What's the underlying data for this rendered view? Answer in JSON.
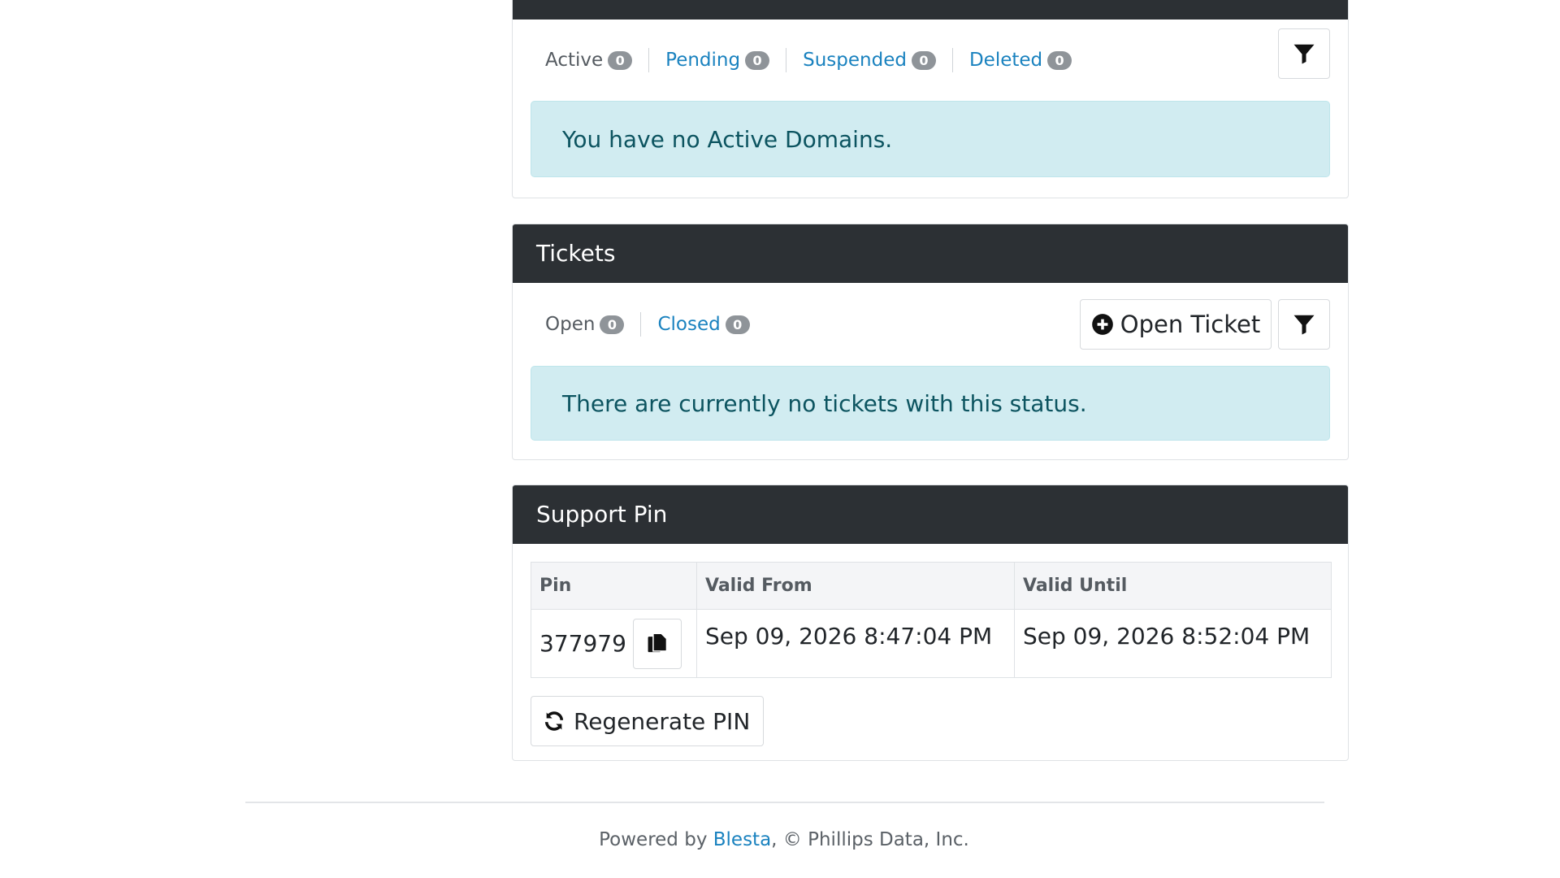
{
  "domains": {
    "tabs": [
      {
        "label": "Active",
        "count": "0"
      },
      {
        "label": "Pending",
        "count": "0"
      },
      {
        "label": "Suspended",
        "count": "0"
      },
      {
        "label": "Deleted",
        "count": "0"
      }
    ],
    "empty_message": "You have no Active Domains."
  },
  "tickets": {
    "title": "Tickets",
    "tabs": [
      {
        "label": "Open",
        "count": "0"
      },
      {
        "label": "Closed",
        "count": "0"
      }
    ],
    "open_ticket_label": "Open Ticket",
    "empty_message": "There are currently no tickets with this status."
  },
  "support_pin": {
    "title": "Support Pin",
    "columns": [
      "Pin",
      "Valid From",
      "Valid Until"
    ],
    "pin": "377979",
    "valid_from": "Sep 09, 2026 8:47:04 PM",
    "valid_until": "Sep 09, 2026 8:52:04 PM",
    "regenerate_label": "Regenerate PIN"
  },
  "footer": {
    "prefix": "Powered by ",
    "link": "Blesta",
    "suffix": ", © Phillips Data, Inc."
  },
  "icons": {
    "filter": "filter-icon",
    "plus_circle": "plus-circle-icon",
    "copy": "copy-icon",
    "refresh": "refresh-icon"
  },
  "colors": {
    "header_bg": "#2c3034",
    "link": "#1a82bf",
    "alert_bg": "#d1ecf1",
    "alert_text": "#0c5460",
    "badge_bg": "#8f9499"
  }
}
